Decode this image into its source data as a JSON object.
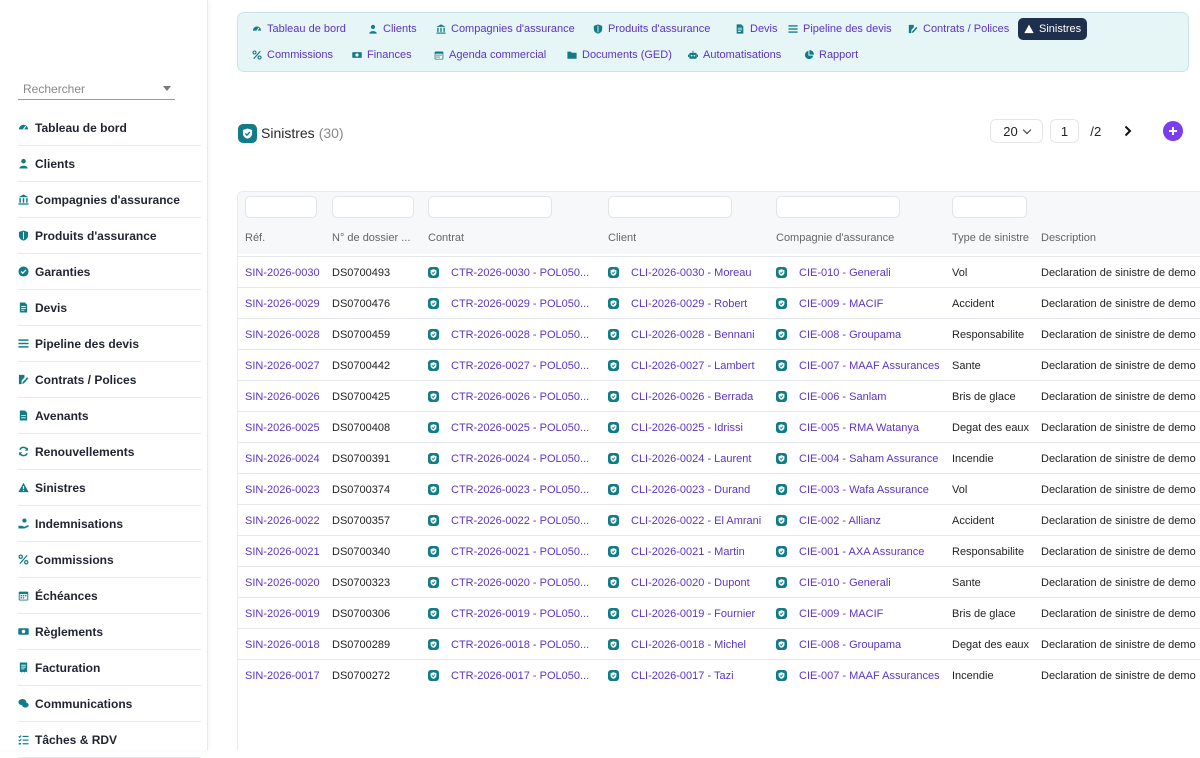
{
  "sidebar": {
    "search_placeholder": "Rechercher",
    "items": [
      {
        "label": "Tableau de bord",
        "icon": "dashboard-icon"
      },
      {
        "label": "Clients",
        "icon": "user-icon"
      },
      {
        "label": "Compagnies d'assurance",
        "icon": "bank-icon"
      },
      {
        "label": "Produits d'assurance",
        "icon": "shield-icon"
      },
      {
        "label": "Garanties",
        "icon": "check-badge-icon"
      },
      {
        "label": "Devis",
        "icon": "document-icon"
      },
      {
        "label": "Pipeline des devis",
        "icon": "list-icon"
      },
      {
        "label": "Contrats / Polices",
        "icon": "signature-icon"
      },
      {
        "label": "Avenants",
        "icon": "file-icon"
      },
      {
        "label": "Renouvellements",
        "icon": "refresh-icon"
      },
      {
        "label": "Sinistres",
        "icon": "warning-icon"
      },
      {
        "label": "Indemnisations",
        "icon": "hand-coin-icon"
      },
      {
        "label": "Commissions",
        "icon": "percent-icon"
      },
      {
        "label": "Échéances",
        "icon": "calendar-icon"
      },
      {
        "label": "Règlements",
        "icon": "money-icon"
      },
      {
        "label": "Facturation",
        "icon": "invoice-icon"
      },
      {
        "label": "Communications",
        "icon": "chat-icon"
      },
      {
        "label": "Tâches & RDV",
        "icon": "tasks-icon"
      }
    ]
  },
  "topnav": {
    "tabs": [
      {
        "label": "Tableau de bord",
        "icon": "dashboard-icon"
      },
      {
        "label": "Clients",
        "icon": "user-icon"
      },
      {
        "label": "Compagnies d'assurance",
        "icon": "bank-icon"
      },
      {
        "label": "Produits d'assurance",
        "icon": "shield-icon"
      },
      {
        "label": "Devis",
        "icon": "document-icon"
      },
      {
        "label": "Pipeline des devis",
        "icon": "list-icon"
      },
      {
        "label": "Contrats / Polices",
        "icon": "signature-icon"
      },
      {
        "label": "Sinistres",
        "icon": "warning-icon",
        "active": true
      },
      {
        "label": "Commissions",
        "icon": "percent-icon"
      },
      {
        "label": "Finances",
        "icon": "money-icon"
      },
      {
        "label": "Agenda commercial",
        "icon": "calendar-icon"
      },
      {
        "label": "Documents (GED)",
        "icon": "folder-icon"
      },
      {
        "label": "Automatisations",
        "icon": "robot-icon"
      },
      {
        "label": "Rapport",
        "icon": "pie-icon"
      }
    ]
  },
  "header": {
    "title": "Sinistres",
    "count": "(30)"
  },
  "pagination": {
    "per_page": "20",
    "current_page": "1",
    "separator": "/",
    "total_pages": "2"
  },
  "table": {
    "columns": [
      "Réf.",
      "N° de dossier ...",
      "Contrat",
      "Client",
      "Compagnie d'assurance",
      "Type de sinistre",
      "Description"
    ],
    "rows": [
      {
        "ref": "SIN-2026-0030",
        "dossier": "DS0700493",
        "contrat": "CTR-2026-0030 - POL050...",
        "client": "CLI-2026-0030 - Moreau",
        "compagnie": "CIE-010 - Generali",
        "type": "Vol",
        "description": "Declaration de sinistre de demo"
      },
      {
        "ref": "SIN-2026-0029",
        "dossier": "DS0700476",
        "contrat": "CTR-2026-0029 - POL050...",
        "client": "CLI-2026-0029 - Robert",
        "compagnie": "CIE-009 - MACIF",
        "type": "Accident",
        "description": "Declaration de sinistre de demo"
      },
      {
        "ref": "SIN-2026-0028",
        "dossier": "DS0700459",
        "contrat": "CTR-2026-0028 - POL050...",
        "client": "CLI-2026-0028 - Bennani",
        "compagnie": "CIE-008 - Groupama",
        "type": "Responsabilite",
        "description": "Declaration de sinistre de demo"
      },
      {
        "ref": "SIN-2026-0027",
        "dossier": "DS0700442",
        "contrat": "CTR-2026-0027 - POL050...",
        "client": "CLI-2026-0027 - Lambert",
        "compagnie": "CIE-007 - MAAF Assurances",
        "type": "Sante",
        "description": "Declaration de sinistre de demo"
      },
      {
        "ref": "SIN-2026-0026",
        "dossier": "DS0700425",
        "contrat": "CTR-2026-0026 - POL050...",
        "client": "CLI-2026-0026 - Berrada",
        "compagnie": "CIE-006 - Sanlam",
        "type": "Bris de glace",
        "description": "Declaration de sinistre de demo"
      },
      {
        "ref": "SIN-2026-0025",
        "dossier": "DS0700408",
        "contrat": "CTR-2026-0025 - POL050...",
        "client": "CLI-2026-0025 - Idrissi",
        "compagnie": "CIE-005 - RMA Watanya",
        "type": "Degat des eaux",
        "description": "Declaration de sinistre de demo"
      },
      {
        "ref": "SIN-2026-0024",
        "dossier": "DS0700391",
        "contrat": "CTR-2026-0024 - POL050...",
        "client": "CLI-2026-0024 - Laurent",
        "compagnie": "CIE-004 - Saham Assurance",
        "type": "Incendie",
        "description": "Declaration de sinistre de demo"
      },
      {
        "ref": "SIN-2026-0023",
        "dossier": "DS0700374",
        "contrat": "CTR-2026-0023 - POL050...",
        "client": "CLI-2026-0023 - Durand",
        "compagnie": "CIE-003 - Wafa Assurance",
        "type": "Vol",
        "description": "Declaration de sinistre de demo"
      },
      {
        "ref": "SIN-2026-0022",
        "dossier": "DS0700357",
        "contrat": "CTR-2026-0022 - POL050...",
        "client": "CLI-2026-0022 - El Amrani",
        "compagnie": "CIE-002 - Allianz",
        "type": "Accident",
        "description": "Declaration de sinistre de demo"
      },
      {
        "ref": "SIN-2026-0021",
        "dossier": "DS0700340",
        "contrat": "CTR-2026-0021 - POL050...",
        "client": "CLI-2026-0021 - Martin",
        "compagnie": "CIE-001 - AXA Assurance",
        "type": "Responsabilite",
        "description": "Declaration de sinistre de demo"
      },
      {
        "ref": "SIN-2026-0020",
        "dossier": "DS0700323",
        "contrat": "CTR-2026-0020 - POL050...",
        "client": "CLI-2026-0020 - Dupont",
        "compagnie": "CIE-010 - Generali",
        "type": "Sante",
        "description": "Declaration de sinistre de demo"
      },
      {
        "ref": "SIN-2026-0019",
        "dossier": "DS0700306",
        "contrat": "CTR-2026-0019 - POL050...",
        "client": "CLI-2026-0019 - Fournier",
        "compagnie": "CIE-009 - MACIF",
        "type": "Bris de glace",
        "description": "Declaration de sinistre de demo"
      },
      {
        "ref": "SIN-2026-0018",
        "dossier": "DS0700289",
        "contrat": "CTR-2026-0018 - POL050...",
        "client": "CLI-2026-0018 - Michel",
        "compagnie": "CIE-008 - Groupama",
        "type": "Degat des eaux",
        "description": "Declaration de sinistre de demo"
      },
      {
        "ref": "SIN-2026-0017",
        "dossier": "DS0700272",
        "contrat": "CTR-2026-0017 - POL050...",
        "client": "CLI-2026-0017 - Tazi",
        "compagnie": "CIE-007 - MAAF Assurances",
        "type": "Incendie",
        "description": "Declaration de sinistre de demo"
      }
    ]
  },
  "colors": {
    "accent": "#5b35c4",
    "teal": "#127c86",
    "active_tab": "#1f2f4e",
    "add_button": "#7b3df0"
  }
}
